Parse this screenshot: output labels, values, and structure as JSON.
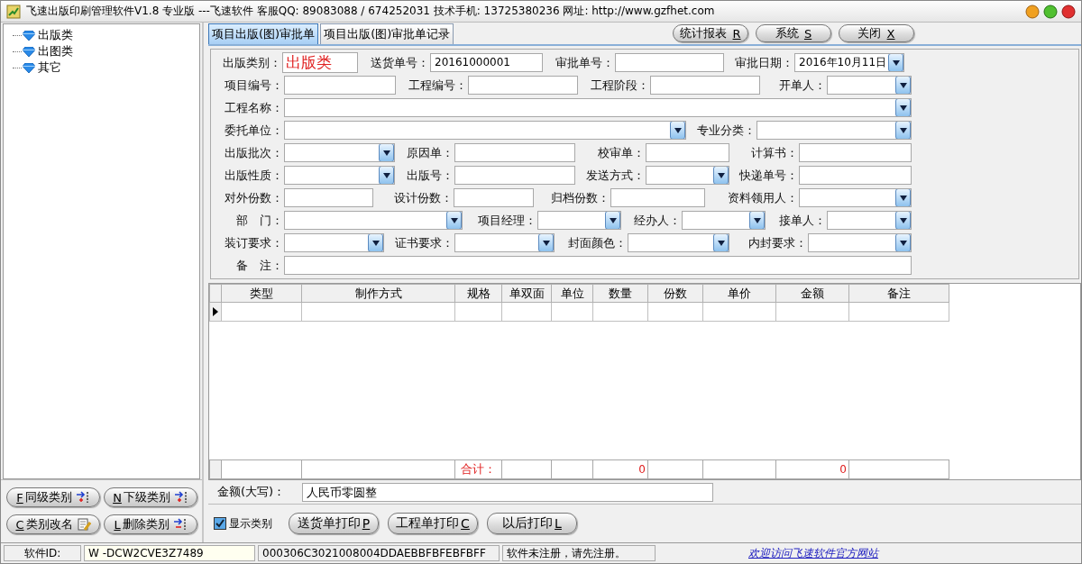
{
  "window": {
    "title": "飞速出版印刷管理软件V1.8 专业版 ---飞速软件 客服QQ: 89083088 / 674252031 技术手机: 13725380236 网址: http://www.gzfhet.com"
  },
  "tree": [
    {
      "label": "出版类"
    },
    {
      "label": "出图类"
    },
    {
      "label": "其它"
    }
  ],
  "tree_buttons": [
    {
      "hotkey": "F",
      "label": "同级类别"
    },
    {
      "hotkey": "N",
      "label": "下级类别"
    },
    {
      "hotkey": "C",
      "label": "类别改名"
    },
    {
      "hotkey": "L",
      "label": "删除类别"
    }
  ],
  "tabs": [
    {
      "label": "项目出版(图)审批单",
      "selected": true
    },
    {
      "label": "项目出版(图)审批单记录",
      "selected": false
    }
  ],
  "toolbar_buttons": [
    {
      "label": "统计报表",
      "hotkey": "R"
    },
    {
      "label": "系统",
      "hotkey": "S"
    },
    {
      "label": "关闭",
      "hotkey": "X"
    }
  ],
  "form": {
    "rows": [
      [
        {
          "label": "出版类别：",
          "kind": "display",
          "value": "出版类"
        },
        {
          "label": "送货单号：",
          "kind": "text",
          "value": "20161000001"
        },
        {
          "label": "审批单号：",
          "kind": "text"
        },
        {
          "label": "审批日期：",
          "kind": "combo",
          "value": "2016年10月11日"
        }
      ],
      [
        {
          "label": "项目编号：",
          "kind": "text"
        },
        {
          "label": "工程编号：",
          "kind": "text"
        },
        {
          "label": "工程阶段：",
          "kind": "text"
        },
        {
          "label": "开单人：",
          "kind": "combo"
        }
      ],
      [
        {
          "label": "工程名称：",
          "kind": "combo"
        }
      ],
      [
        {
          "label": "委托单位：",
          "kind": "combo"
        },
        {
          "label": "专业分类：",
          "kind": "combo"
        }
      ],
      [
        {
          "label": "出版批次：",
          "kind": "combo"
        },
        {
          "label": "原因单：",
          "kind": "text"
        },
        {
          "label": "校审单：",
          "kind": "text"
        },
        {
          "label": "计算书：",
          "kind": "text"
        }
      ],
      [
        {
          "label": "出版性质：",
          "kind": "combo"
        },
        {
          "label": "出版号：",
          "kind": "text"
        },
        {
          "label": "发送方式：",
          "kind": "combo"
        },
        {
          "label": "快递单号：",
          "kind": "text"
        }
      ],
      [
        {
          "label": "对外份数：",
          "kind": "text"
        },
        {
          "label": "设计份数：",
          "kind": "text"
        },
        {
          "label": "归档份数：",
          "kind": "text"
        },
        {
          "label": "资料领用人：",
          "kind": "combo"
        }
      ],
      [
        {
          "label": "部　门：",
          "kind": "combo"
        },
        {
          "label": "项目经理：",
          "kind": "combo"
        },
        {
          "label": "经办人：",
          "kind": "combo"
        },
        {
          "label": "接单人：",
          "kind": "combo"
        }
      ],
      [
        {
          "label": "装订要求：",
          "kind": "combo"
        },
        {
          "label": "证书要求：",
          "kind": "combo"
        },
        {
          "label": "封面颜色：",
          "kind": "combo"
        },
        {
          "label": "内封要求：",
          "kind": "combo"
        }
      ],
      [
        {
          "label": "备　注：",
          "kind": "text"
        }
      ]
    ]
  },
  "table": {
    "columns": [
      "类型",
      "制作方式",
      "规格",
      "单双面",
      "单位",
      "数量",
      "份数",
      "单价",
      "金额",
      "备注"
    ],
    "rows": [
      {
        "current": true
      }
    ],
    "totals": {
      "label": "合计：",
      "quantity": "0",
      "amount": "0"
    }
  },
  "amount_in_words": {
    "label": "金额(大写)：",
    "value": "人民币零圆整"
  },
  "show_category": {
    "label": "显示类别",
    "checked": true
  },
  "print_buttons": [
    {
      "label": "送货单打印",
      "hotkey": "P"
    },
    {
      "label": "工程单打印",
      "hotkey": "C"
    },
    {
      "label": "以后打印",
      "hotkey": "L"
    }
  ],
  "status_bar": {
    "id_label": "软件ID:",
    "id_value": "W -DCW2CVE3Z7489",
    "code": "000306C3021008004DDAEBBFBFEBFBFF",
    "message": "软件未注册，请先注册。",
    "link": "欢迎访问飞速软件官方网站"
  }
}
